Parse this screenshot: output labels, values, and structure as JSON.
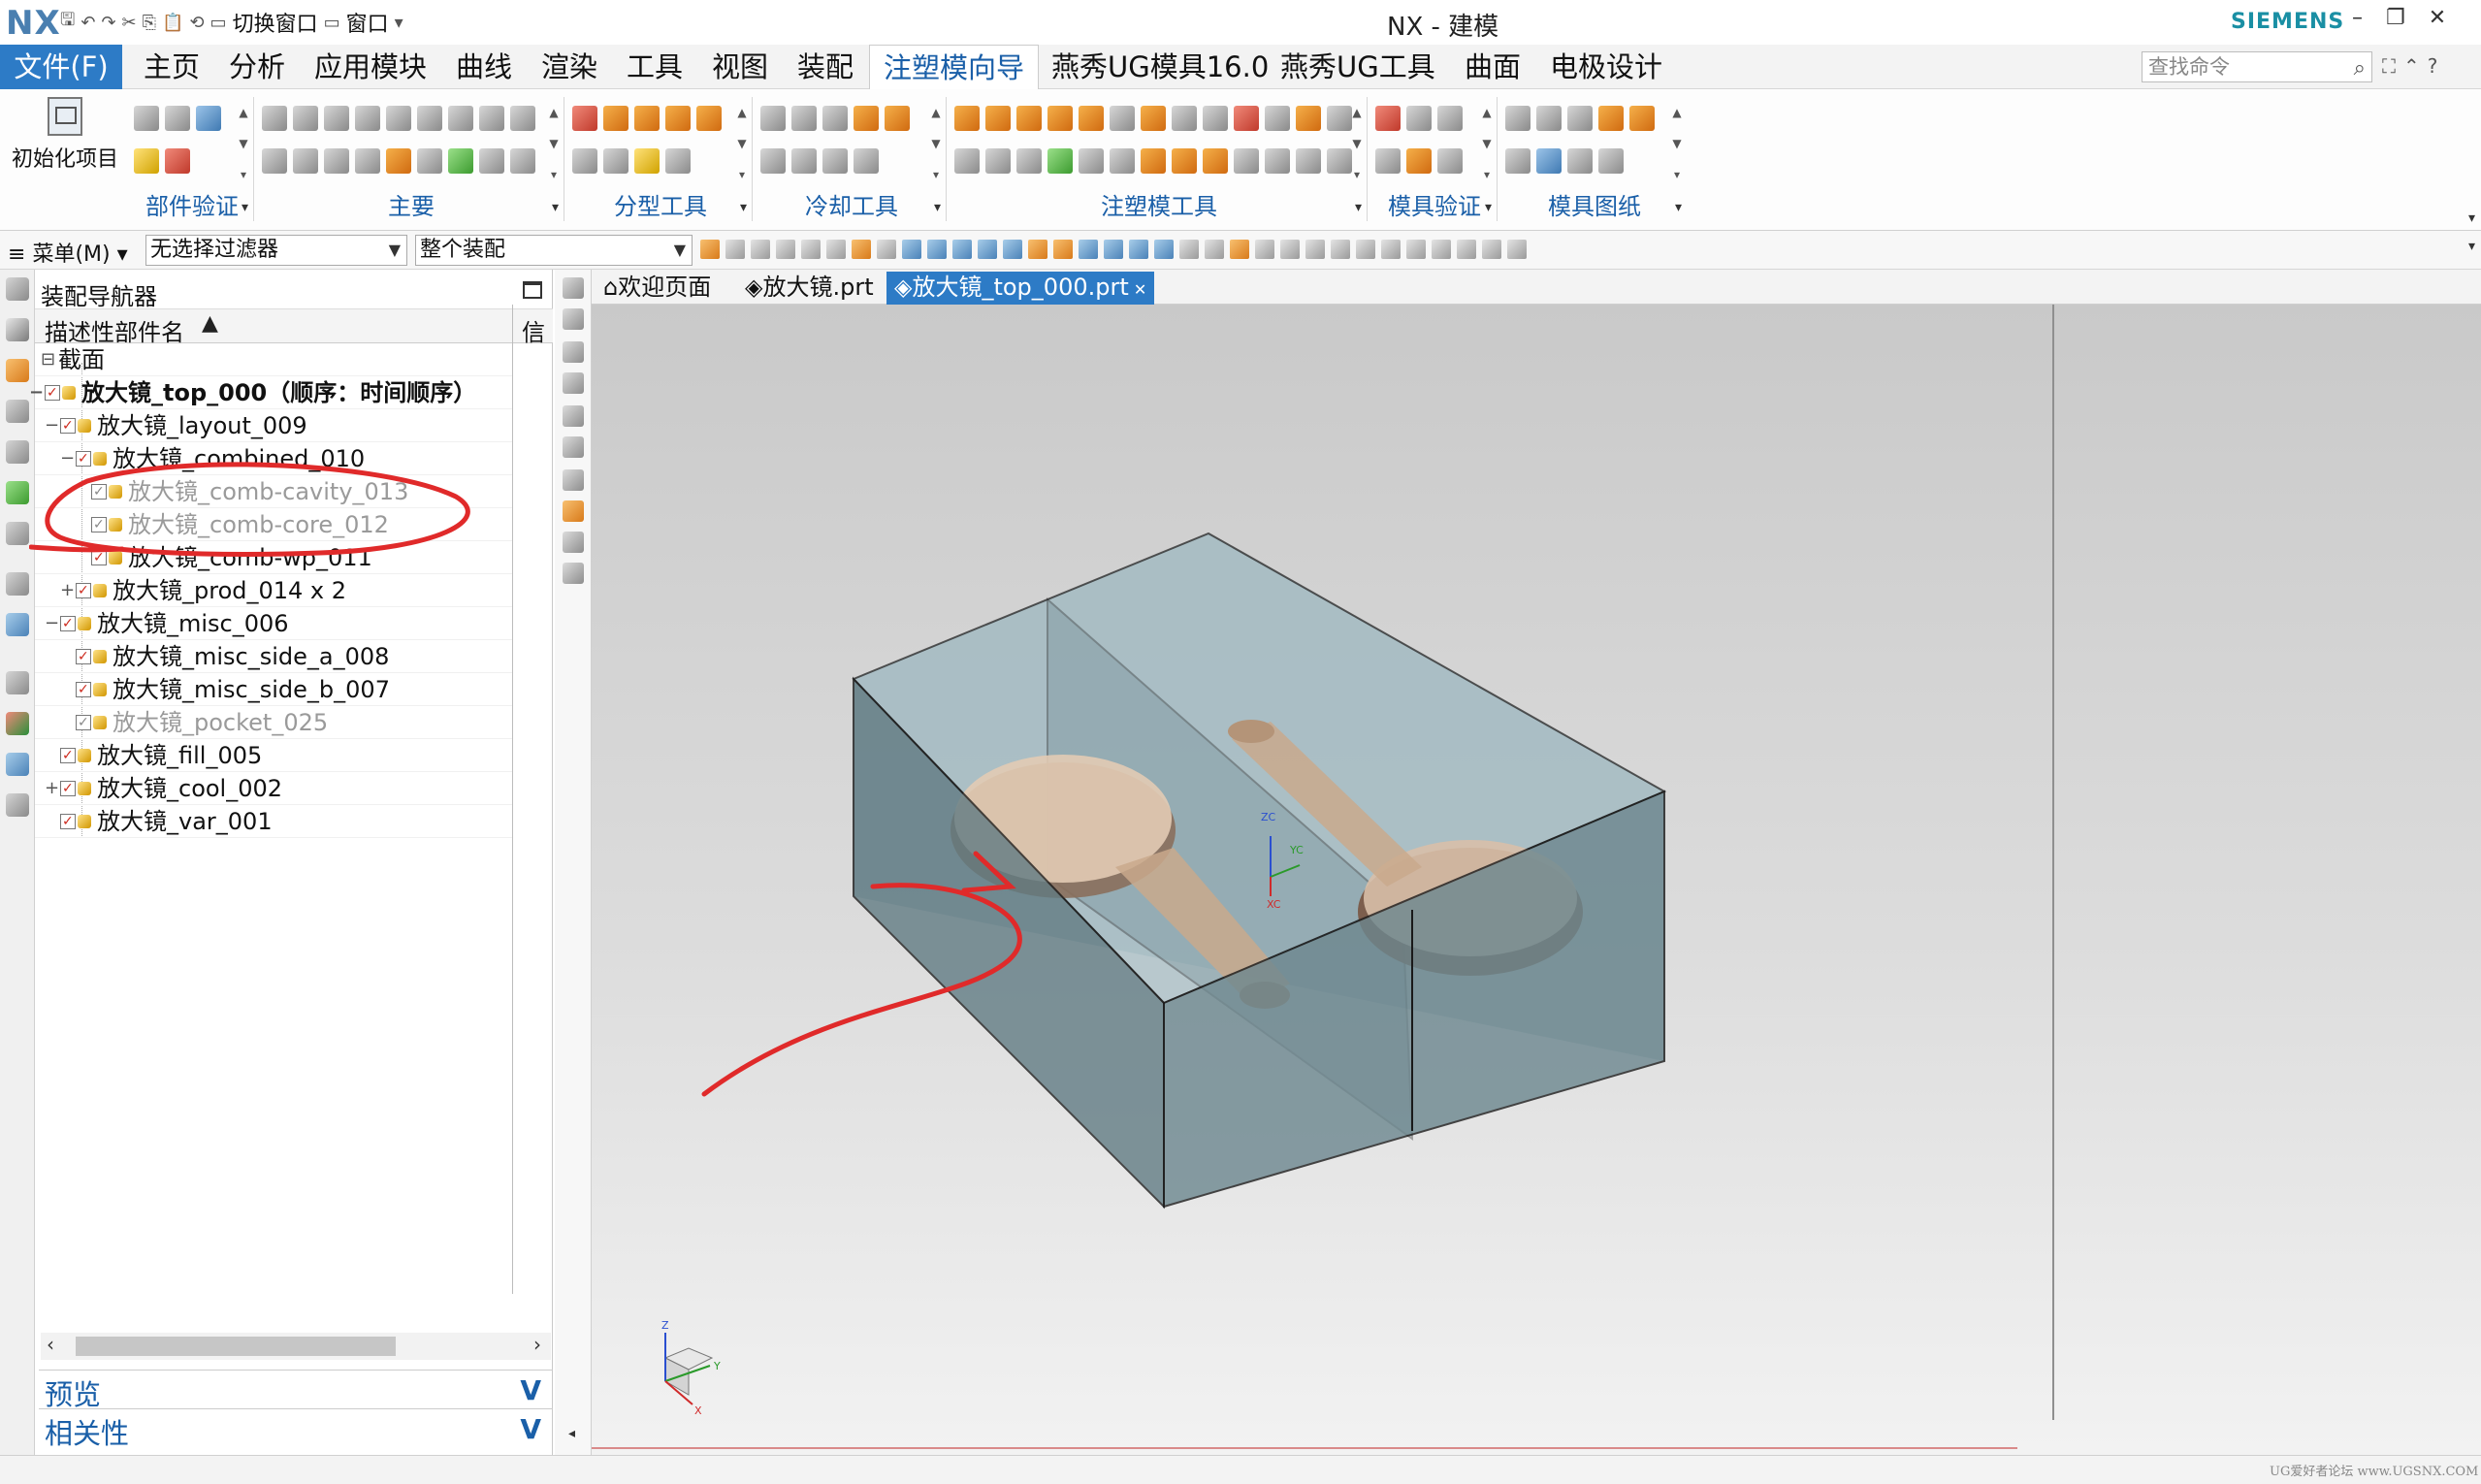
{
  "titlebar": {
    "logo": "NX",
    "switch_window": "切换窗口",
    "window_menu": "窗口",
    "title": "NX - 建模",
    "brand": "SIEMENS"
  },
  "tabs": {
    "file": "文件(F)",
    "items": [
      "主页",
      "分析",
      "应用模块",
      "曲线",
      "渲染",
      "工具",
      "视图",
      "装配",
      "注塑模向导",
      "燕秀UG模具16.0",
      "燕秀UG工具",
      "曲面",
      "电极设计"
    ],
    "active": "注塑模向导",
    "search_placeholder": "查找命令"
  },
  "ribbon": {
    "init_project": "初始化项目",
    "groups": [
      "部件验证",
      "主要",
      "分型工具",
      "冷却工具",
      "注塑模工具",
      "模具验证",
      "模具图纸"
    ]
  },
  "filterbar": {
    "menu": "菜单(M)",
    "filter": "无选择过滤器",
    "scope": "整个装配"
  },
  "navigator": {
    "title": "装配导航器",
    "col_name": "描述性部件名",
    "col_info": "信",
    "rows": [
      {
        "label": "截面",
        "indent": 0,
        "check": false,
        "part": false,
        "style": "normal",
        "twisty": "⊟"
      },
      {
        "label": "放大镜_top_000（顺序：时间顺序）",
        "indent": 0,
        "check": true,
        "part": true,
        "style": "bold",
        "twisty": "−"
      },
      {
        "label": "放大镜_layout_009",
        "indent": 1,
        "check": true,
        "part": true,
        "style": "normal",
        "twisty": "−"
      },
      {
        "label": "放大镜_combined_010",
        "indent": 2,
        "check": true,
        "part": true,
        "style": "normal",
        "twisty": "−"
      },
      {
        "label": "放大镜_comb-cavity_013",
        "indent": 3,
        "check": true,
        "part": true,
        "style": "dim",
        "twisty": ""
      },
      {
        "label": "放大镜_comb-core_012",
        "indent": 3,
        "check": true,
        "part": true,
        "style": "dim",
        "twisty": ""
      },
      {
        "label": "放大镜_comb-wp_011",
        "indent": 3,
        "check": true,
        "part": true,
        "style": "normal",
        "twisty": ""
      },
      {
        "label": "放大镜_prod_014 x 2",
        "indent": 2,
        "check": true,
        "part": true,
        "style": "normal",
        "twisty": "+"
      },
      {
        "label": "放大镜_misc_006",
        "indent": 1,
        "check": true,
        "part": true,
        "style": "normal",
        "twisty": "−"
      },
      {
        "label": "放大镜_misc_side_a_008",
        "indent": 2,
        "check": true,
        "part": true,
        "style": "normal",
        "twisty": ""
      },
      {
        "label": "放大镜_misc_side_b_007",
        "indent": 2,
        "check": true,
        "part": true,
        "style": "normal",
        "twisty": ""
      },
      {
        "label": "放大镜_pocket_025",
        "indent": 2,
        "check": true,
        "part": true,
        "style": "dim",
        "twisty": ""
      },
      {
        "label": "放大镜_fill_005",
        "indent": 1,
        "check": true,
        "part": true,
        "style": "normal",
        "twisty": ""
      },
      {
        "label": "放大镜_cool_002",
        "indent": 1,
        "check": true,
        "part": true,
        "style": "normal",
        "twisty": "+"
      },
      {
        "label": "放大镜_var_001",
        "indent": 1,
        "check": true,
        "part": true,
        "style": "normal",
        "twisty": ""
      }
    ],
    "preview": "预览",
    "dependencies": "相关性"
  },
  "doc_tabs": [
    "欢迎页面",
    "放大镜.prt",
    "放大镜_top_000.prt"
  ],
  "doc_tab_active": "放大镜_top_000.prt",
  "viewport": {
    "wcs_labels": {
      "zc": "ZC",
      "yc": "YC",
      "xc": "XC"
    },
    "triad_labels": {
      "z": "Z",
      "y": "Y",
      "x": "X"
    }
  },
  "watermark": "UG爱好者论坛 www.UGSNX.COM",
  "colors": {
    "accent": "#2d7bc6",
    "annotation": "#e02a2a",
    "box_face": "#5f7a82",
    "part": "#c9a98c"
  }
}
